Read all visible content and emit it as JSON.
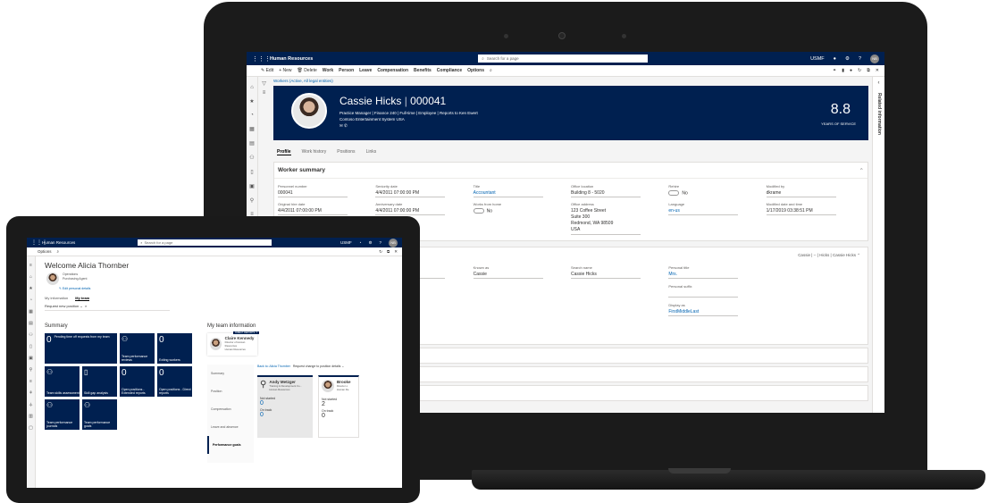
{
  "laptop": {
    "topbar": {
      "app_title": "Human Resources",
      "search_placeholder": "Search for a page",
      "company": "USMF",
      "user_initials": "NB"
    },
    "actions": {
      "edit": "Edit",
      "new": "New",
      "delete": "Delete",
      "work": "Work",
      "person": "Person",
      "leave": "Leave",
      "compensation": "Compensation",
      "benefits": "Benefits",
      "compliance": "Compliance",
      "options": "Options"
    },
    "breadcrumb": "Workers (Active, All legal entities)",
    "header": {
      "name": "Cassie Hicks",
      "separator": "|",
      "id": "000041",
      "line1": "Practice Manager  |  Finance 240  |  Full-time  |  Employee  |  Reports to Ken Ewert",
      "line2": "Contoso Entertainment System USA",
      "years": "8.8",
      "years_label": "YEARS OF SERVICE"
    },
    "tabs": [
      "Profile",
      "Work history",
      "Positions",
      "Links"
    ],
    "right_panel_label": "Related information",
    "worker_summary": {
      "title": "Worker summary",
      "fields": [
        {
          "label": "Personnel number",
          "value": "000041",
          "link": false
        },
        {
          "label": "Seniority date",
          "value": "4/4/2011 07:00:00 PM",
          "link": false
        },
        {
          "label": "Title",
          "value": "Accountant",
          "link": true
        },
        {
          "label": "Office location",
          "value": "Building 8 - 5020",
          "link": false
        },
        {
          "label": "Rehire",
          "value": "No",
          "link": false
        },
        {
          "label": "Modified by",
          "value": "dkrame",
          "link": false
        },
        {
          "label": "Original hire date",
          "value": "4/4/2011 07:00:00 PM",
          "link": false
        },
        {
          "label": "Anniversary date",
          "value": "4/4/2011 07:00:00 PM",
          "link": false
        },
        {
          "label": "Works from home",
          "value": "No",
          "link": false
        },
        {
          "label": "Office address",
          "value": "123 Coffee Street",
          "link": false
        },
        {
          "label": "Language",
          "value": "en-us",
          "link": true
        },
        {
          "label": "Modified date and time",
          "value": "1/17/2019 03:38:51 PM",
          "link": false
        }
      ],
      "address_lines": [
        "Suite 300",
        "Redmond, WA 98509",
        "USA"
      ]
    },
    "name_card": {
      "header_right": "Cassie  |  --  |  Hicks  |  Cassie Hicks",
      "fields": [
        {
          "label": "Last name",
          "value": "Hicks",
          "link": false
        },
        {
          "label": "Known as",
          "value": "Cassie",
          "link": false
        },
        {
          "label": "Search name",
          "value": "Cassie Hicks",
          "link": false
        },
        {
          "label": "Personal title",
          "value": "Mrs.",
          "link": true
        }
      ],
      "personal_suffix_label": "Personal suffix",
      "display_as_label": "Display as",
      "display_as_value": "FirstMiddleLast"
    }
  },
  "tablet": {
    "topbar": {
      "app_title": "Human Resources",
      "search_placeholder": "Search for a page",
      "company": "USMF",
      "user_initials": "NB"
    },
    "options_label": "Options",
    "welcome": "Welcome Alicia Thornber",
    "role_line1": "Operations",
    "role_line2": "Purchasing Agent",
    "edit_details": "Edit personal details",
    "tabs": [
      "My information",
      "My team"
    ],
    "request_new_position": "Request new position",
    "summary_title": "Summary",
    "tiles": {
      "pending_num": "0",
      "pending_label": "Pending time off requests from my team",
      "team_perf_reviews": "Team performance reviews",
      "existing_num": "0",
      "existing_workers": "Exiting workers",
      "team_skills": "Team skills assessment",
      "skill_gap": "Skill gap analysis",
      "open_ext_num": "0",
      "open_ext_label": "Open positions - Extended reports",
      "open_direct_num": "0",
      "open_direct_label": "Open positions - Direct reports",
      "team_perf_journals": "Team performance journals",
      "team_perf_goals": "Team performance goals"
    },
    "team": {
      "title": "My team information",
      "direct_reports_flag": "DIRECT REPORTS: 7",
      "manager_name": "Claire Kennedy",
      "manager_title": "Director of Human Resources",
      "manager_dept": "Human Resources",
      "side_items": [
        "Summary",
        "Position",
        "Compensation",
        "Leave and absence",
        "Performance goals"
      ],
      "back_link": "Back to: Alicia Thornber",
      "request_change": "Request change to position details",
      "person1": {
        "name": "Andy Metzger",
        "title": "Training & Development Co...",
        "dept": "Human Resources",
        "status1": "Not started",
        "num1": "0",
        "status2": "On track",
        "num2": "0"
      },
      "person2": {
        "name": "Brooke",
        "title": "Director o",
        "dept": "Human Re",
        "status1": "Not started",
        "num1": "2",
        "status2": "On track",
        "num2": "0"
      }
    }
  }
}
